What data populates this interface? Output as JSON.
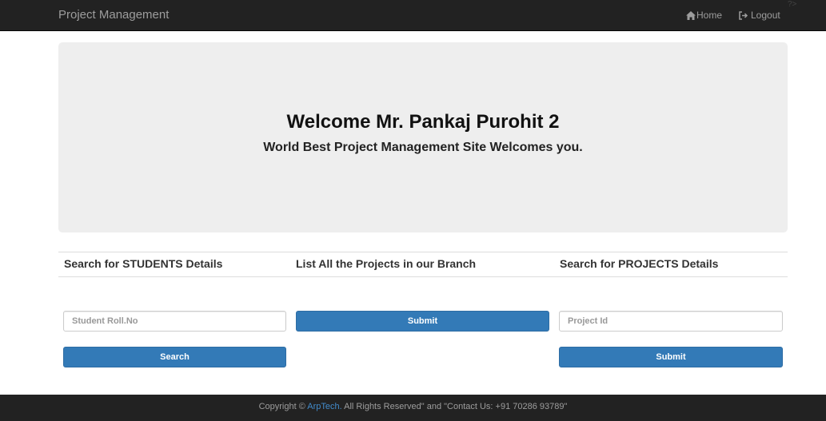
{
  "navbar": {
    "brand": "Project Management",
    "home_label": "Home",
    "logout_label": "Logout",
    "corner_mark": "?>"
  },
  "jumbotron": {
    "welcome": "Welcome Mr. Pankaj Purohit 2",
    "tagline": "World Best Project Management Site Welcomes you."
  },
  "columns": {
    "students": {
      "heading": "Search for STUDENTS Details",
      "input_placeholder": "Student Roll.No",
      "button_label": "Search"
    },
    "branch": {
      "heading": "List All the Projects in our Branch",
      "button_label": "Submit"
    },
    "projects": {
      "heading": "Search for PROJECTS Details",
      "input_placeholder": "Project Id",
      "button_label": "Submit"
    }
  },
  "footer": {
    "prefix": "Copyright © ",
    "company": "ArpTech.",
    "suffix": " All Rights Reserved\" and \"Contact Us: +91 70286 93789\""
  },
  "colors": {
    "navbar_bg": "#222222",
    "jumbotron_bg": "#eeeeee",
    "primary_button": "#337ab7",
    "link": "#428bca"
  }
}
